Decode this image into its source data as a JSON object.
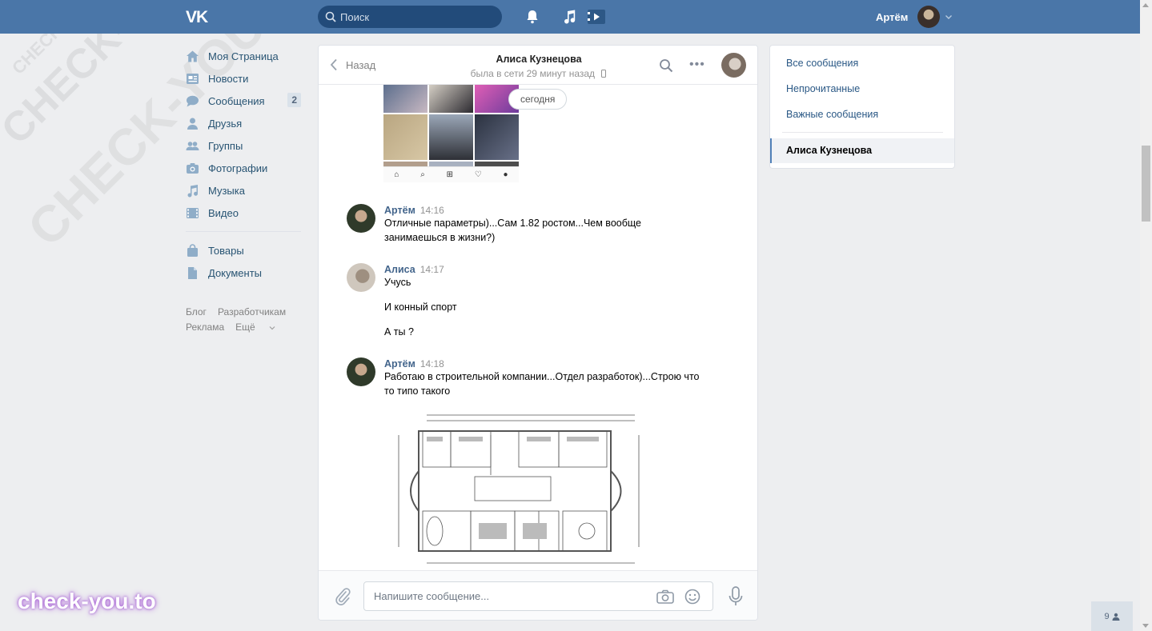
{
  "header": {
    "logo": "VK",
    "search_placeholder": "Поиск",
    "user_name": "Артём"
  },
  "left_nav": {
    "items": [
      {
        "label": "Моя Страница",
        "icon": "home-icon"
      },
      {
        "label": "Новости",
        "icon": "news-icon"
      },
      {
        "label": "Сообщения",
        "icon": "messages-icon",
        "badge": "2"
      },
      {
        "label": "Друзья",
        "icon": "friend-icon"
      },
      {
        "label": "Группы",
        "icon": "groups-icon"
      },
      {
        "label": "Фотографии",
        "icon": "camera-icon"
      },
      {
        "label": "Музыка",
        "icon": "music-icon"
      },
      {
        "label": "Видео",
        "icon": "video-icon"
      }
    ],
    "items2": [
      {
        "label": "Товары",
        "icon": "bag-icon"
      },
      {
        "label": "Документы",
        "icon": "document-icon"
      }
    ],
    "footer": [
      "Блог",
      "Разработчикам",
      "Реклама",
      "Ещё"
    ]
  },
  "chat": {
    "back_label": "Назад",
    "title": "Алиса Кузнецова",
    "status": "была в сети 29 минут назад",
    "date_pill": "сегодня",
    "messages": [
      {
        "name": "Артём",
        "time": "14:16",
        "texts": [
          "Отличные параметры)...Сам 1.82 ростом...Чем вообще занимаешься в жизни?)"
        ]
      },
      {
        "name": "Алиса",
        "time": "14:17",
        "texts": [
          "Учусь",
          "И конный спорт",
          "А ты ?"
        ]
      },
      {
        "name": "Артём",
        "time": "14:18",
        "texts": [
          "Работаю в строительной компании...Отдел разработок)...Строю что то типо такого"
        ]
      }
    ],
    "input_placeholder": "Напишите сообщение..."
  },
  "right_panel": {
    "filters": [
      "Все сообщения",
      "Непрочитанные",
      "Важные сообщения"
    ],
    "active_dialog": "Алиса Кузнецова"
  },
  "online_count": "9",
  "watermark": {
    "large": "CHECK-YOU.ME",
    "brand": "check-you.to"
  },
  "colors": {
    "header": "#4a76a8",
    "link": "#2a5885",
    "background": "#edeef0"
  }
}
